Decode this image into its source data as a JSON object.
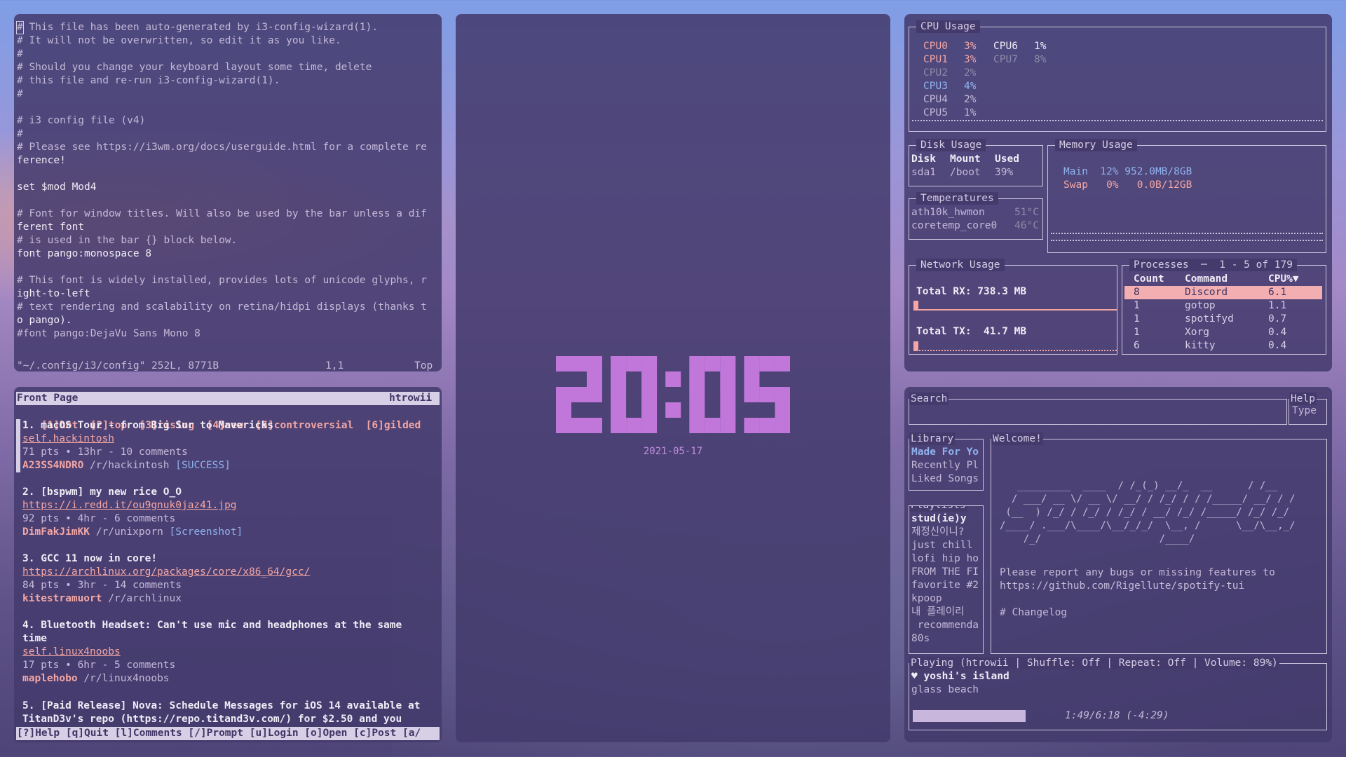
{
  "vim": {
    "lines": [
      "# This file has been auto-generated by i3-config-wizard(1).",
      "# It will not be overwritten, so edit it as you like.",
      "#",
      "# Should you change your keyboard layout some time, delete",
      "# this file and re-run i3-config-wizard(1).",
      "#",
      "",
      "# i3 config file (v4)",
      "#",
      "# Please see https://i3wm.org/docs/userguide.html for a complete re",
      "ference!",
      "",
      "set $mod Mod4",
      "",
      "# Font for window titles. Will also be used by the bar unless a dif",
      "ferent font",
      "# is used in the bar {} block below.",
      "font pango:monospace 8",
      "",
      "# This font is widely installed, provides lots of unicode glyphs, r",
      "ight-to-left",
      "# text rendering and scalability on retina/hidpi displays (thanks t",
      "o pango).",
      "#font pango:DejaVu Sans Mono 8"
    ],
    "status_file": "\"~/.config/i3/config\" 252L, 8771B",
    "status_pos": "1,1",
    "status_scroll": "Top"
  },
  "reddit": {
    "title": "Front Page",
    "user": "htrowii",
    "tabs": [
      "[1]hot",
      "[2]top",
      "[3]rising",
      "[4]new",
      "[5]controversial",
      "[6]gilded"
    ],
    "posts": [
      {
        "title": "1. macOS Tour - from Big Sur to Mavericks",
        "title2": "",
        "link": "self.hackintosh",
        "meta": "71 pts • 13hr - 10 comments",
        "author": "A23SS4NDRO",
        "sub": "/r/hackintosh",
        "flair": "[SUCCESS]"
      },
      {
        "title": "2. [bspwm] my new rice O_O",
        "title2": "",
        "link": "https://i.redd.it/ou9gnuk0jaz41.jpg",
        "meta": "92 pts • 4hr - 6 comments",
        "author": "DimFakJimKK",
        "sub": "/r/unixporn",
        "flair": "[Screenshot]"
      },
      {
        "title": "3. GCC 11 now in core!",
        "title2": "",
        "link": "https://archlinux.org/packages/core/x86_64/gcc/",
        "meta": "84 pts • 3hr - 14 comments",
        "author": "kitestramuort",
        "sub": "/r/archlinux",
        "flair": ""
      },
      {
        "title": "4. Bluetooth Headset: Can't use mic and headphones at the same",
        "title2": "time",
        "link": "self.linux4noobs",
        "meta": "17 pts • 6hr - 5 comments",
        "author": "maplehobo",
        "sub": "/r/linux4noobs",
        "flair": ""
      }
    ],
    "post5_line1": "5. [Paid Release] Nova: Schedule Messages for iOS 14 available at",
    "post5_line2": "TitanD3v's repo (https://repo.titand3v.com/) for $2.50 and you",
    "footer": "[?]Help [q]Quit [l]Comments [/]Prompt [u]Login [o]Open [c]Post [a/"
  },
  "clock": {
    "time": "20:05",
    "date": "2021-05-17"
  },
  "gotop": {
    "cpu_title": "CPU Usage",
    "cpus": [
      {
        "name": "CPU0",
        "val": "3%",
        "color": "#f3a6a4"
      },
      {
        "name": "CPU1",
        "val": "3%",
        "color": "#f3a6a4"
      },
      {
        "name": "CPU2",
        "val": "2%",
        "color": "#8f8aa8"
      },
      {
        "name": "CPU3",
        "val": "4%",
        "color": "#8fb3ee"
      },
      {
        "name": "CPU4",
        "val": "2%",
        "color": "#c4b9d8"
      },
      {
        "name": "CPU5",
        "val": "1%",
        "color": "#c4b9d8"
      },
      {
        "name": "CPU6",
        "val": "1%",
        "color": "#f0ecf6"
      },
      {
        "name": "CPU7",
        "val": "8%",
        "color": "#8f8aa8"
      }
    ],
    "disk_title": "Disk Usage",
    "disk_headers": [
      "Disk",
      "Mount",
      "Used"
    ],
    "disk_row": [
      "sda1",
      "/boot",
      "39%"
    ],
    "mem_title": "Memory Usage",
    "mem_main": "Main  12% 952.0MB/8GB",
    "mem_swap": "Swap   0%   0.0B/12GB",
    "temp_title": "Temperatures",
    "temps": [
      {
        "name": "ath10k_hwmon",
        "val": "51°C"
      },
      {
        "name": "coretemp_core0",
        "val": "46°C"
      }
    ],
    "net_title": "Network Usage",
    "rx": "Total RX: 738.3 MB",
    "tx": "Total TX:  41.7 MB",
    "proc_title": "Processes",
    "proc_range": "1 - 5 of 179",
    "proc_headers": [
      "Count",
      "Command",
      "CPU%▼"
    ],
    "procs": [
      {
        "count": "8",
        "cmd": "Discord",
        "cpu": "6.1"
      },
      {
        "count": "1",
        "cmd": "gotop",
        "cpu": "1.1"
      },
      {
        "count": "1",
        "cmd": "spotifyd",
        "cpu": "0.7"
      },
      {
        "count": "1",
        "cmd": "Xorg",
        "cpu": "0.4"
      },
      {
        "count": "6",
        "cmd": "kitty",
        "cpu": "0.4"
      }
    ]
  },
  "spotify": {
    "search_label": "Search",
    "help_label": "Help",
    "help_value": "Type",
    "library_label": "Library",
    "library_items": [
      "Made For Yo",
      "Recently Pl",
      "Liked Songs"
    ],
    "playlists_label": "Playlists",
    "playlists": [
      "stud(ie)y",
      "제정신이니?",
      "just chill",
      "lofi hip ho",
      "FROM THE FI",
      "favorite #2",
      "kpoop",
      "내 플레이리",
      " recommenda",
      "80s"
    ],
    "welcome_label": "Welcome!",
    "ascii": [
      "   _________  ____  / /_(_) __/_  __      / /__",
      "  / ___/ __ \\/ __ \\/ __/ / /_/ / / /_____/ __/ / /",
      " (__  ) /_/ / /_/ / /_/ / __/ /_/ /_____/ /_/ /_/",
      "/____/ .___/\\____/\\__/_/_/  \\__, /      \\__/\\__,_/",
      "    /_/                    /____/"
    ],
    "report1": "Please report any bugs or missing features to",
    "report2": "https://github.com/Rigellute/spotify-tui",
    "changelog": "# Changelog",
    "playing_label": "Playing (htrowii | Shuffle: Off | Repeat: Off   | Volume: 89%)",
    "track": "♥ yoshi's island",
    "artist": "glass beach",
    "time": "1:49/6:18 (-4:29)",
    "progress": 0.29
  }
}
